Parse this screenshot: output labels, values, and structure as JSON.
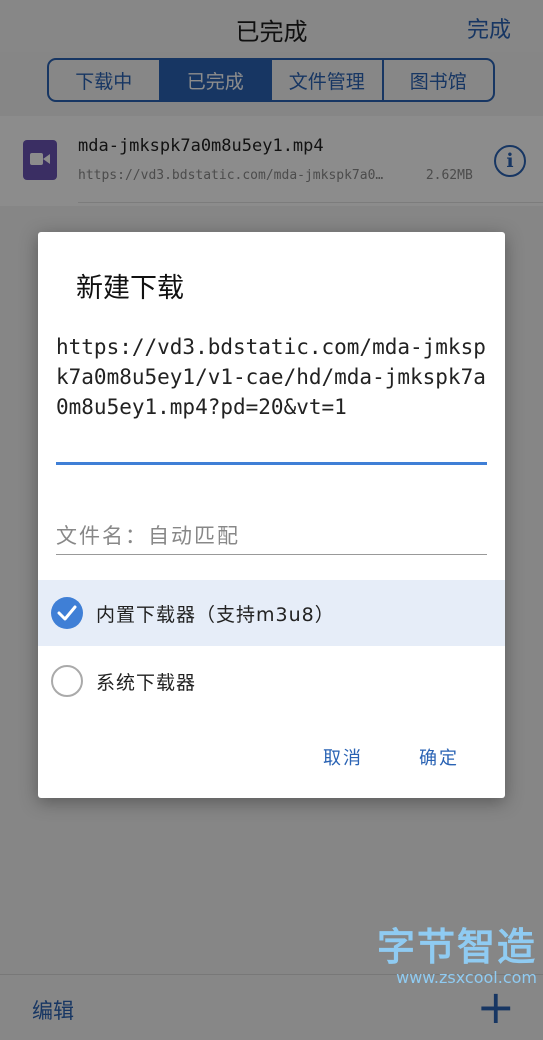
{
  "header": {
    "title": "已完成",
    "done_label": "完成"
  },
  "tabs": [
    {
      "label": "下载中",
      "active": false
    },
    {
      "label": "已完成",
      "active": true
    },
    {
      "label": "文件管理",
      "active": false
    },
    {
      "label": "图书馆",
      "active": false
    }
  ],
  "file": {
    "name": "mda-jmkspk7a0m8u5ey1.mp4",
    "url": "https://vd3.bdstatic.com/mda-jmkspk7a0…",
    "size": "2.62MB",
    "icon": "video-file-icon"
  },
  "footer": {
    "edit_label": "编辑",
    "add_label": "+"
  },
  "watermark": {
    "title": "字节智造",
    "url": "www.zsxcool.com"
  },
  "dialog": {
    "title": "新建下载",
    "url_value": "https://vd3.bdstatic.com/mda-jmkspk7a0m8u5ey1/v1-cae/hd/mda-jmkspk7a0m8u5ey1.mp4?pd=20&vt=1",
    "filename_placeholder": "文件名：自动匹配",
    "options": [
      {
        "label": "内置下载器（支持m3u8）",
        "selected": true
      },
      {
        "label": "系统下载器",
        "selected": false
      }
    ],
    "cancel_label": "取消",
    "ok_label": "确定"
  },
  "colors": {
    "accent": "#2a63b4",
    "dialog_accent": "#3f7fd6",
    "file_icon": "#6a55b5",
    "watermark": "#8fcbf2"
  }
}
